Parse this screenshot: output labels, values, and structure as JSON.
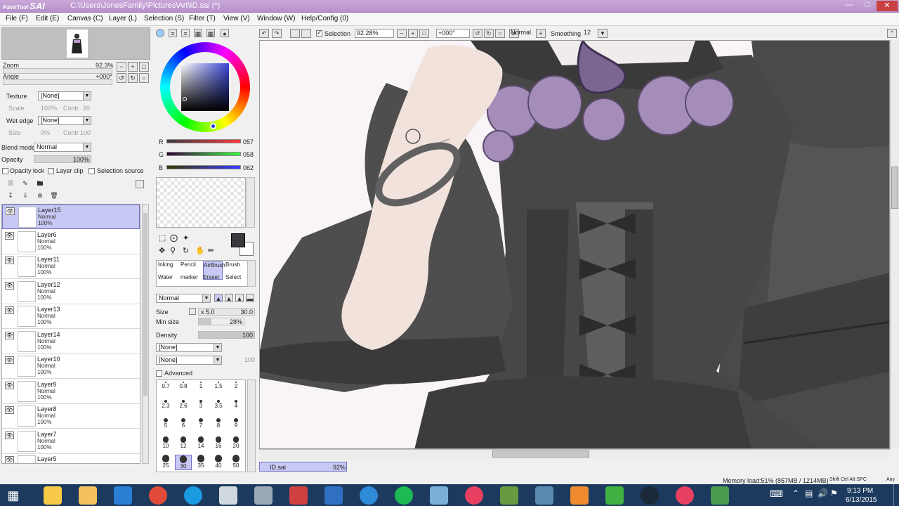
{
  "title_bar": {
    "logo_small": "PaintTool",
    "logo": "SAI",
    "path": "C:\\Users\\JonesFamily\\Pictures\\Art\\ID.sai (*)"
  },
  "menu": [
    "File (F)",
    "Edit (E)",
    "Canvas (C)",
    "Layer (L)",
    "Selection (S)",
    "Filter (T)",
    "View (V)",
    "Window (W)",
    "Help/Config (0)"
  ],
  "navigator": {
    "zoom_label": "Zoom",
    "zoom_value": "92.3%",
    "angle_label": "Angle",
    "angle_value": "+000°"
  },
  "layer_props": {
    "texture_label": "Texture",
    "texture_value": "[None]",
    "scale_label": "Scale",
    "scale_value": "100%",
    "texture_contrast_label": "Contr",
    "texture_contrast_value": "20",
    "wet_edge_label": "Wet edge",
    "wet_edge_value": "[None]",
    "size_label": "Size",
    "size_value": "0%",
    "wet_edge_contrast_label": "Contr",
    "wet_edge_contrast_value": "100",
    "blend_mode_label": "Blend mode",
    "blend_mode_value": "Normal",
    "opacity_label": "Opacity",
    "opacity_value": "100%",
    "opacity_lock": "Opacity lock",
    "layer_clip": "Layer clip",
    "selection_source": "Selection source"
  },
  "layers": [
    {
      "name": "Layer15",
      "mode": "Normal",
      "opacity": "100%",
      "selected": true
    },
    {
      "name": "Layer6",
      "mode": "Normal",
      "opacity": "100%",
      "selected": false
    },
    {
      "name": "Layer11",
      "mode": "Normal",
      "opacity": "100%",
      "selected": false
    },
    {
      "name": "Layer12",
      "mode": "Normal",
      "opacity": "100%",
      "selected": false
    },
    {
      "name": "Layer13",
      "mode": "Normal",
      "opacity": "100%",
      "selected": false
    },
    {
      "name": "Layer14",
      "mode": "Normal",
      "opacity": "100%",
      "selected": false
    },
    {
      "name": "Layer10",
      "mode": "Normal",
      "opacity": "100%",
      "selected": false
    },
    {
      "name": "Layer9",
      "mode": "Normal",
      "opacity": "100%",
      "selected": false
    },
    {
      "name": "Layer8",
      "mode": "Normal",
      "opacity": "100%",
      "selected": false
    },
    {
      "name": "Layer7",
      "mode": "Normal",
      "opacity": "100%",
      "selected": false
    },
    {
      "name": "Layer5",
      "mode": "",
      "opacity": "",
      "selected": false
    }
  ],
  "color": {
    "r_label": "R",
    "r_value": "057",
    "g_label": "G",
    "g_value": "058",
    "b_label": "B",
    "b_value": "062",
    "current": "#393a3e"
  },
  "tools": [
    {
      "label": "Inking",
      "selected": false
    },
    {
      "label": "Pencil",
      "selected": false
    },
    {
      "label": "AirBrush",
      "selected": true
    },
    {
      "label": "Brush",
      "selected": false
    },
    {
      "label": "Water",
      "selected": false
    },
    {
      "label": "marker",
      "selected": false
    },
    {
      "label": "Eraser",
      "selected": false
    },
    {
      "label": "Select",
      "selected": false
    }
  ],
  "brush": {
    "mode": "Normal",
    "size_label": "Size",
    "size_mult": "x 5.0",
    "size_value": "30.0",
    "min_size_label": "Min size",
    "min_size_value": "28%",
    "density_label": "Density",
    "density_value": "100",
    "shape": "[None]",
    "texture": "[None]",
    "texture_value": "100",
    "advanced": "Advanced",
    "presets": [
      "0.7",
      "0.8",
      "1",
      "1.5",
      "2",
      "2.3",
      "2.6",
      "3",
      "3.5",
      "4",
      "5",
      "6",
      "7",
      "8",
      "9",
      "10",
      "12",
      "14",
      "16",
      "20",
      "25",
      "30",
      "35",
      "40",
      "50"
    ]
  },
  "canvas_toolbar": {
    "selection": "Selection",
    "zoom": "92.28%",
    "angle": "+000°",
    "mode": "Normal",
    "smoothing_label": "Smoothing",
    "smoothing_value": "12"
  },
  "status": {
    "doc_name": "ID.sai",
    "doc_zoom": "92%",
    "memory": "Memory load:51% (857MB / 1214MB)",
    "keys": "Shift Ctrl Alt SPC",
    "any": "Any"
  },
  "taskbar": {
    "time": "9:13 PM",
    "date": "6/13/2015"
  }
}
